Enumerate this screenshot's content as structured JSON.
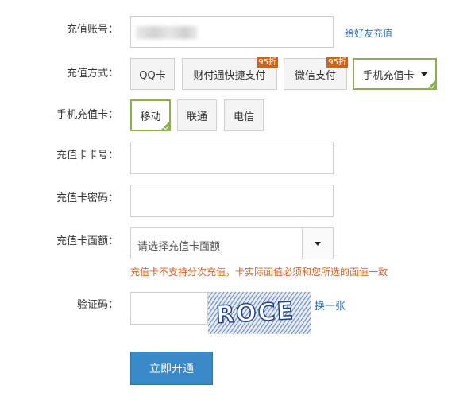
{
  "form": {
    "account": {
      "label": "充值账号：",
      "link": "给好友充值"
    },
    "method": {
      "label": "充值方式：",
      "options": [
        {
          "label": "QQ卡",
          "badge": "",
          "selected": false
        },
        {
          "label": "财付通快捷支付",
          "badge": "95折",
          "selected": false
        },
        {
          "label": "微信支付",
          "badge": "95折",
          "selected": false
        },
        {
          "label": "手机充值卡",
          "badge": "",
          "selected": true,
          "dropdown": true
        }
      ]
    },
    "carrier": {
      "label": "手机充值卡：",
      "options": [
        {
          "label": "移动",
          "selected": true
        },
        {
          "label": "联通",
          "selected": false
        },
        {
          "label": "电信",
          "selected": false
        }
      ]
    },
    "card_number": {
      "label": "充值卡卡号：",
      "value": ""
    },
    "card_password": {
      "label": "充值卡密码：",
      "value": ""
    },
    "denomination": {
      "label": "充值卡面额：",
      "selected": "请选择充值卡面额",
      "warning": "充值卡不支持分次充值，卡实际面值必须和您所选的面值一致"
    },
    "captcha": {
      "label": "验证码：",
      "value": "",
      "image_text": "ROCE",
      "refresh_link": "换一张"
    },
    "submit_label": "立即开通"
  },
  "colors": {
    "accent_green": "#8bb24a",
    "badge_orange": "#d9600e",
    "link_blue": "#2a6db4",
    "warning_orange": "#e0601c",
    "button_blue": "#3a89c9"
  }
}
